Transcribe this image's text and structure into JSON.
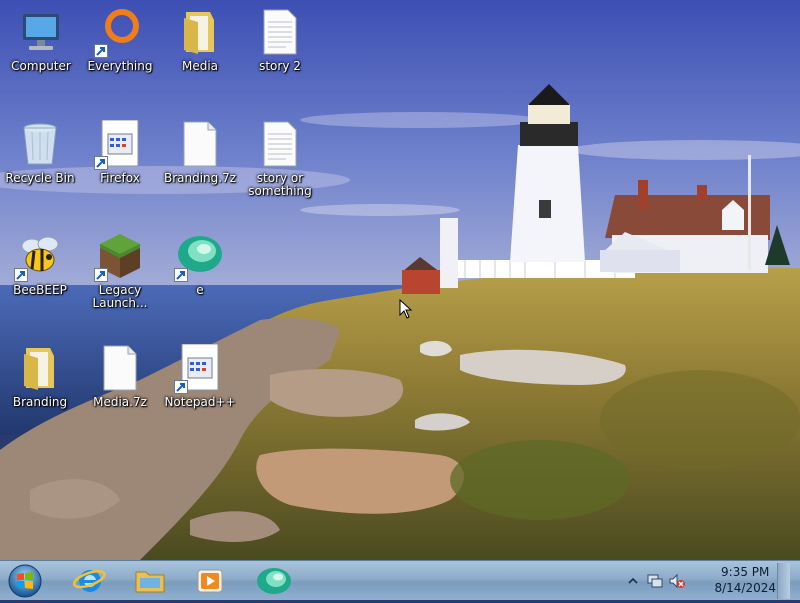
{
  "desktop": {
    "icons": [
      {
        "label": "Computer",
        "icon": "computer-icon",
        "shortcut": false
      },
      {
        "label": "Everything",
        "icon": "everything-icon",
        "shortcut": true
      },
      {
        "label": "Media",
        "icon": "folder-icon",
        "shortcut": false
      },
      {
        "label": "story 2",
        "icon": "text-file-icon",
        "shortcut": false
      },
      {
        "label": "Recycle Bin",
        "icon": "recycle-bin-icon",
        "shortcut": false
      },
      {
        "label": "Firefox",
        "icon": "firefox-shortcut-icon",
        "shortcut": true
      },
      {
        "label": "Branding.7z",
        "icon": "archive-file-icon",
        "shortcut": false
      },
      {
        "label": "story or something",
        "icon": "text-file-icon",
        "shortcut": false
      },
      {
        "label": "BeeBEEP",
        "icon": "bee-icon",
        "shortcut": true
      },
      {
        "label": "Legacy Launch...",
        "icon": "minecraft-block-icon",
        "shortcut": true
      },
      {
        "label": "e",
        "icon": "e-app-icon",
        "shortcut": true
      },
      {
        "label": "Branding",
        "icon": "folder-icon",
        "shortcut": false
      },
      {
        "label": "Media.7z",
        "icon": "archive-file-icon",
        "shortcut": false
      },
      {
        "label": "Notepad++",
        "icon": "notepad-plus-plus-icon",
        "shortcut": true
      }
    ]
  },
  "taskbar": {
    "start_icon": "windows-start-orb-icon",
    "pinned": [
      "internet-explorer-icon",
      "file-explorer-icon",
      "media-player-icon",
      "e-app-icon"
    ],
    "tray": {
      "icons": [
        "show-hidden-icons-chevron",
        "network-icon",
        "volume-muted-icon"
      ],
      "time": "9:35 PM",
      "date": "8/14/2024"
    }
  },
  "colors": {
    "taskbar": "#8eacc9",
    "sky": "#4a5fb8",
    "sea": "#3d5fa8",
    "grass": "#9a8a3a"
  }
}
